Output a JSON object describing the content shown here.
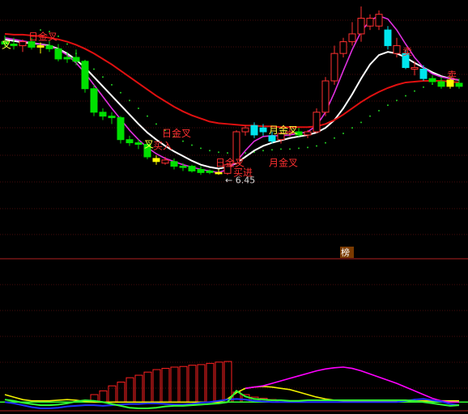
{
  "colors": {
    "background": "#000000",
    "grid": "#8b1a1a",
    "divider": "#b02020",
    "up": "#ff3030",
    "down_green": "#00e000",
    "down_cyan": "#00e5ee",
    "ma_white": "#ffffff",
    "ma_red": "#e01010",
    "ma_magenta": "#e030e0",
    "dots": "#22cc22",
    "ind_green": "#33ff33",
    "ind_blue": "#2030ff",
    "ind_yellow": "#f0f000",
    "ind_magenta": "#ff00ff",
    "ind_bar": "#ff2020",
    "label_red": "#ff3030",
    "label_yellow": "#ffff40",
    "price_label": "#d8d8d8"
  },
  "chart_data": {
    "type": "candlestick",
    "title": "",
    "price_range": [
      5.4,
      8.6
    ],
    "low_marker": {
      "text": "← 6.45",
      "value": 6.45
    },
    "candles": [
      {
        "o": 8.15,
        "h": 8.23,
        "l": 8.08,
        "c": 8.12,
        "color": "green"
      },
      {
        "o": 8.12,
        "h": 8.2,
        "l": 8.05,
        "c": 8.1,
        "color": "green"
      },
      {
        "o": 8.1,
        "h": 8.18,
        "l": 8.02,
        "c": 8.15,
        "color": "red"
      },
      {
        "o": 8.15,
        "h": 8.2,
        "l": 8.05,
        "c": 8.08,
        "color": "green"
      },
      {
        "o": 8.08,
        "h": 8.14,
        "l": 8.0,
        "c": 8.1,
        "color": "yellow"
      },
      {
        "o": 8.1,
        "h": 8.16,
        "l": 8.02,
        "c": 8.06,
        "color": "green"
      },
      {
        "o": 8.06,
        "h": 8.12,
        "l": 7.9,
        "c": 7.93,
        "color": "green"
      },
      {
        "o": 7.93,
        "h": 8.02,
        "l": 7.88,
        "c": 7.95,
        "color": "green"
      },
      {
        "o": 7.95,
        "h": 8.05,
        "l": 7.85,
        "c": 7.9,
        "color": "green"
      },
      {
        "o": 7.9,
        "h": 7.92,
        "l": 7.5,
        "c": 7.55,
        "color": "green"
      },
      {
        "o": 7.55,
        "h": 7.6,
        "l": 7.2,
        "c": 7.25,
        "color": "green"
      },
      {
        "o": 7.25,
        "h": 7.3,
        "l": 7.15,
        "c": 7.2,
        "color": "green"
      },
      {
        "o": 7.2,
        "h": 7.25,
        "l": 7.1,
        "c": 7.18,
        "color": "green"
      },
      {
        "o": 7.18,
        "h": 7.2,
        "l": 6.85,
        "c": 6.9,
        "color": "green"
      },
      {
        "o": 6.9,
        "h": 6.95,
        "l": 6.82,
        "c": 6.86,
        "color": "green"
      },
      {
        "o": 6.86,
        "h": 6.9,
        "l": 6.78,
        "c": 6.84,
        "color": "green"
      },
      {
        "o": 6.84,
        "h": 6.86,
        "l": 6.65,
        "c": 6.68,
        "color": "green"
      },
      {
        "o": 6.66,
        "h": 6.7,
        "l": 6.58,
        "c": 6.62,
        "color": "yellow"
      },
      {
        "o": 6.64,
        "h": 6.68,
        "l": 6.58,
        "c": 6.6,
        "color": "red"
      },
      {
        "o": 6.62,
        "h": 6.66,
        "l": 6.52,
        "c": 6.56,
        "color": "green"
      },
      {
        "o": 6.56,
        "h": 6.6,
        "l": 6.5,
        "c": 6.55,
        "color": "green"
      },
      {
        "o": 6.56,
        "h": 6.58,
        "l": 6.48,
        "c": 6.5,
        "color": "green"
      },
      {
        "o": 6.52,
        "h": 6.56,
        "l": 6.45,
        "c": 6.48,
        "color": "green"
      },
      {
        "o": 6.5,
        "h": 6.52,
        "l": 6.46,
        "c": 6.48,
        "color": "green"
      },
      {
        "o": 6.48,
        "h": 6.52,
        "l": 6.45,
        "c": 6.47,
        "color": "yellow"
      },
      {
        "o": 6.47,
        "h": 6.6,
        "l": 6.45,
        "c": 6.58,
        "color": "red"
      },
      {
        "o": 6.6,
        "h": 7.02,
        "l": 6.58,
        "c": 7.0,
        "color": "red"
      },
      {
        "o": 7.0,
        "h": 7.08,
        "l": 6.95,
        "c": 7.05,
        "color": "red"
      },
      {
        "o": 7.08,
        "h": 7.12,
        "l": 6.92,
        "c": 6.96,
        "color": "cyan"
      },
      {
        "o": 7.05,
        "h": 7.1,
        "l": 6.95,
        "c": 7.0,
        "color": "cyan"
      },
      {
        "o": 6.95,
        "h": 7.0,
        "l": 6.85,
        "c": 6.88,
        "color": "cyan"
      },
      {
        "o": 6.9,
        "h": 7.0,
        "l": 6.85,
        "c": 6.98,
        "color": "red"
      },
      {
        "o": 6.98,
        "h": 7.05,
        "l": 6.94,
        "c": 7.0,
        "color": "red"
      },
      {
        "o": 7.0,
        "h": 7.05,
        "l": 6.94,
        "c": 6.96,
        "color": "green"
      },
      {
        "o": 6.96,
        "h": 7.02,
        "l": 6.92,
        "c": 7.0,
        "color": "red"
      },
      {
        "o": 7.0,
        "h": 7.3,
        "l": 6.98,
        "c": 7.25,
        "color": "red"
      },
      {
        "o": 7.25,
        "h": 7.7,
        "l": 7.2,
        "c": 7.65,
        "color": "red"
      },
      {
        "o": 7.65,
        "h": 8.1,
        "l": 7.6,
        "c": 8.0,
        "color": "red"
      },
      {
        "o": 8.0,
        "h": 8.2,
        "l": 7.95,
        "c": 8.15,
        "color": "red"
      },
      {
        "o": 8.15,
        "h": 8.4,
        "l": 8.1,
        "c": 8.25,
        "color": "red"
      },
      {
        "o": 8.25,
        "h": 8.6,
        "l": 8.15,
        "c": 8.45,
        "color": "red"
      },
      {
        "o": 8.45,
        "h": 8.5,
        "l": 8.3,
        "c": 8.35,
        "color": "red"
      },
      {
        "o": 8.35,
        "h": 8.55,
        "l": 8.3,
        "c": 8.5,
        "color": "red"
      },
      {
        "o": 8.3,
        "h": 8.35,
        "l": 8.05,
        "c": 8.1,
        "color": "cyan"
      },
      {
        "o": 8.1,
        "h": 8.2,
        "l": 7.95,
        "c": 8.0,
        "color": "red"
      },
      {
        "o": 8.0,
        "h": 8.05,
        "l": 7.8,
        "c": 7.82,
        "color": "cyan"
      },
      {
        "o": 7.82,
        "h": 7.9,
        "l": 7.72,
        "c": 7.8,
        "color": "red"
      },
      {
        "o": 7.8,
        "h": 7.85,
        "l": 7.65,
        "c": 7.68,
        "color": "cyan"
      },
      {
        "o": 7.68,
        "h": 7.72,
        "l": 7.6,
        "c": 7.64,
        "color": "green"
      },
      {
        "o": 7.64,
        "h": 7.7,
        "l": 7.55,
        "c": 7.58,
        "color": "green"
      },
      {
        "o": 7.58,
        "h": 7.7,
        "l": 7.55,
        "c": 7.66,
        "color": "yellow"
      },
      {
        "o": 7.62,
        "h": 7.68,
        "l": 7.55,
        "c": 7.58,
        "color": "green"
      }
    ],
    "series": [
      {
        "color": "white",
        "values": [
          8.18,
          8.16,
          8.14,
          8.13,
          8.12,
          8.1,
          8.06,
          8.0,
          7.92,
          7.82,
          7.7,
          7.58,
          7.46,
          7.34,
          7.22,
          7.1,
          6.99,
          6.9,
          6.82,
          6.75,
          6.69,
          6.63,
          6.58,
          6.55,
          6.53,
          6.55,
          6.6,
          6.68,
          6.76,
          6.82,
          6.86,
          6.89,
          6.92,
          6.94,
          6.96,
          6.99,
          7.05,
          7.15,
          7.3,
          7.48,
          7.68,
          7.86,
          7.98,
          8.02,
          8.0,
          7.95,
          7.88,
          7.82,
          7.76,
          7.71,
          7.68,
          7.66
        ]
      },
      {
        "color": "red",
        "values": [
          8.25,
          8.24,
          8.24,
          8.23,
          8.22,
          8.2,
          8.18,
          8.15,
          8.11,
          8.06,
          8.0,
          7.93,
          7.86,
          7.78,
          7.7,
          7.62,
          7.54,
          7.46,
          7.39,
          7.32,
          7.26,
          7.21,
          7.17,
          7.13,
          7.11,
          7.1,
          7.09,
          7.08,
          7.08,
          7.07,
          7.07,
          7.06,
          7.06,
          7.06,
          7.06,
          7.07,
          7.1,
          7.15,
          7.22,
          7.3,
          7.38,
          7.45,
          7.51,
          7.56,
          7.6,
          7.63,
          7.64,
          7.65,
          7.65,
          7.65,
          7.64,
          7.63
        ]
      },
      {
        "color": "magenta",
        "values": [
          8.2,
          8.18,
          8.16,
          8.14,
          8.12,
          8.09,
          8.05,
          7.98,
          7.88,
          7.75,
          7.6,
          7.45,
          7.3,
          7.16,
          7.02,
          6.9,
          6.8,
          6.72,
          6.66,
          6.62,
          6.58,
          6.55,
          6.52,
          6.5,
          6.48,
          6.52,
          6.62,
          6.76,
          6.88,
          6.94,
          6.95,
          6.95,
          6.96,
          6.98,
          7.0,
          7.08,
          7.25,
          7.5,
          7.78,
          8.05,
          8.28,
          8.42,
          8.48,
          8.44,
          8.3,
          8.12,
          7.95,
          7.82,
          7.74,
          7.7,
          7.68,
          7.66
        ]
      }
    ],
    "dots": [
      null,
      null,
      null,
      null,
      8.3,
      8.28,
      8.22,
      8.12,
      8.0,
      7.9,
      7.8,
      7.7,
      7.6,
      7.5,
      7.4,
      7.3,
      7.2,
      7.1,
      7.02,
      6.94,
      6.88,
      6.83,
      6.79,
      6.76,
      6.74,
      6.73,
      6.73,
      6.73,
      6.74,
      6.76,
      6.77,
      6.78,
      6.78,
      6.79,
      6.8,
      6.82,
      6.86,
      6.92,
      6.98,
      7.05,
      7.12,
      7.2,
      7.27,
      7.34,
      7.4,
      7.46,
      7.52,
      7.57,
      7.61,
      7.64,
      7.66,
      null
    ],
    "signals": [
      {
        "text": "日金叉",
        "index": 3,
        "value": 8.17,
        "color": "red"
      },
      {
        "text": "叉",
        "index": 0,
        "value": 8.07,
        "color": "yellow"
      },
      {
        "text": "日金叉",
        "index": 18,
        "value": 6.94,
        "color": "red"
      },
      {
        "text": "叉",
        "index": 16,
        "value": 6.8,
        "color": "yellow"
      },
      {
        "text": "买入",
        "index": 17,
        "value": 6.78,
        "color": "red"
      },
      {
        "text": "日金叉",
        "index": 24,
        "value": 6.56,
        "color": "red"
      },
      {
        "text": "月金叉",
        "index": 30,
        "value": 6.56,
        "color": "red"
      },
      {
        "text": "买进",
        "index": 26,
        "value": 6.44,
        "color": "red"
      },
      {
        "text": "月金叉",
        "index": 30,
        "value": 6.98,
        "color": "yellow"
      },
      {
        "text": "卖",
        "index": 45,
        "value": 7.98,
        "color": "red"
      },
      {
        "text": "卖",
        "index": 50,
        "value": 7.68,
        "color": "red"
      }
    ],
    "indicator": {
      "range": [
        -1,
        10
      ],
      "bars": [
        0,
        0,
        0,
        0,
        0,
        0,
        0,
        0,
        0,
        0.3,
        1.2,
        1.8,
        2.6,
        3.2,
        3.9,
        4.3,
        4.8,
        5.2,
        5.4,
        5.6,
        5.7,
        5.9,
        6.0,
        6.2,
        6.4,
        6.5,
        1.6,
        1.2,
        0.8,
        0.6,
        0.4,
        0.3,
        0.2,
        0,
        0,
        0,
        0,
        0,
        0,
        0,
        0,
        0,
        0,
        0,
        0,
        0,
        0,
        0,
        0,
        0,
        0,
        0
      ],
      "green": [
        0.4,
        0.2,
        -0.1,
        -0.3,
        -0.5,
        -0.5,
        -0.4,
        -0.2,
        0.1,
        0.3,
        0.2,
        0,
        -0.3,
        -0.6,
        -0.9,
        -1.0,
        -1.0,
        -0.9,
        -0.7,
        -0.6,
        -0.6,
        -0.5,
        -0.4,
        -0.3,
        -0.2,
        0,
        1.8,
        0.9,
        0.5,
        0.4,
        0.3,
        0.3,
        0.2,
        0.2,
        0.3,
        0.3,
        0.3,
        0.3,
        0.3,
        0.3,
        0.3,
        0.3,
        0.3,
        0.3,
        0.3,
        0.3,
        0.2,
        0,
        -0.2,
        -0.4,
        -0.6,
        -0.5
      ],
      "blue": [
        0,
        -0.2,
        -0.5,
        -0.8,
        -1.0,
        -1.0,
        -0.9,
        -0.7,
        -0.6,
        -0.5,
        -0.5,
        -0.6,
        -0.5,
        -0.4,
        -0.3,
        -0.3,
        -0.2,
        -0.2,
        -0.3,
        -0.4,
        -0.4,
        -0.3,
        -0.1,
        0,
        0.2,
        0.4,
        0.5,
        0.4,
        0.2,
        0.1,
        0,
        0,
        0,
        0,
        0,
        0,
        0,
        0,
        0,
        0,
        0,
        0,
        0,
        0,
        0,
        0.2,
        0.4,
        0.5,
        0.3,
        0.1,
        -0.3,
        -0.5
      ],
      "yellow": [
        1.2,
        0.8,
        0.4,
        0.2,
        0.2,
        0.2,
        0.3,
        0.4,
        0.3,
        0.1,
        0,
        0,
        0,
        0,
        0,
        0,
        0,
        0,
        0,
        0,
        0,
        0,
        0,
        0,
        0,
        0.5,
        1.5,
        2.2,
        2.4,
        2.5,
        2.4,
        2.2,
        2.0,
        1.6,
        1.2,
        0.8,
        0.5,
        0.3,
        0.2,
        0.2,
        0.2,
        0.2,
        0.2,
        0.2,
        0.2,
        0.2,
        0.2,
        0.2,
        0.2,
        0.2,
        0.2,
        0.2
      ],
      "magenta": [
        null,
        null,
        null,
        null,
        null,
        null,
        null,
        null,
        null,
        null,
        null,
        null,
        null,
        null,
        null,
        null,
        null,
        null,
        null,
        null,
        null,
        null,
        null,
        null,
        null,
        null,
        null,
        2.2,
        2.4,
        2.6,
        3.0,
        3.4,
        3.8,
        4.2,
        4.6,
        5.0,
        5.3,
        5.5,
        5.6,
        5.4,
        5.0,
        4.5,
        4.0,
        3.5,
        3.0,
        2.4,
        1.8,
        1.2,
        0.6,
        0.2,
        0,
        0
      ]
    },
    "panel_tag": "榜"
  }
}
